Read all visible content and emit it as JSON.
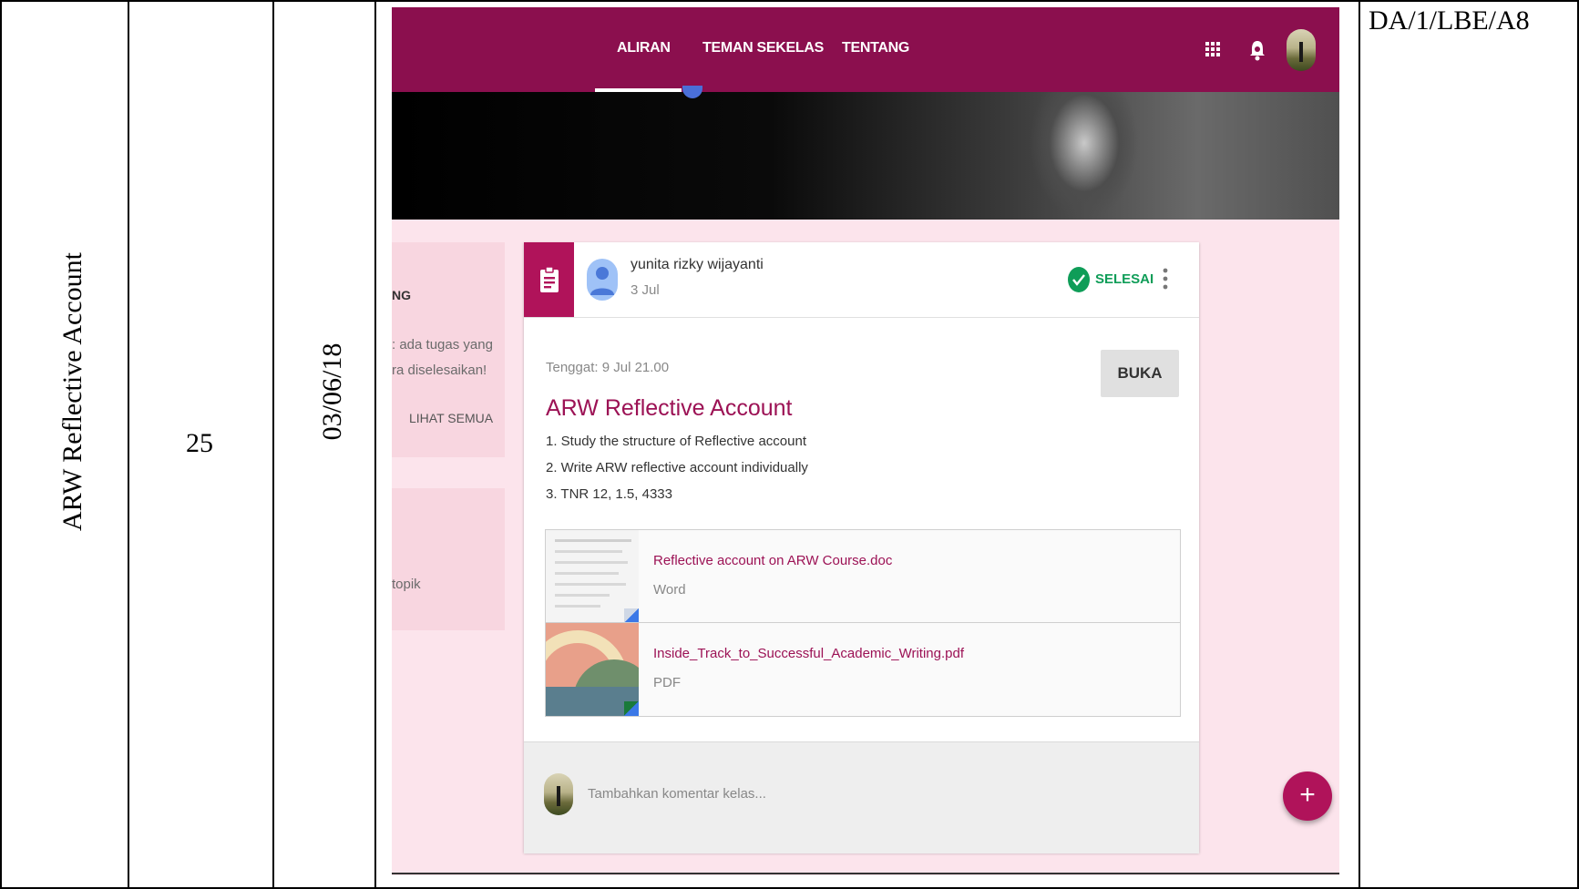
{
  "table": {
    "activity": "ARW Reflective Account",
    "meeting_no": "25",
    "date": "03/06/18",
    "code": "DA/1/LBE/A8"
  },
  "classroom": {
    "tabs": [
      "ALIRAN",
      "TEMAN SEKELAS",
      "TENTANG"
    ],
    "active_tab": "ALIRAN",
    "sidebar": {
      "heading_fragment": "NG",
      "message_line1": ": ada tugas yang",
      "message_line2": "ra diselesaikan!",
      "see_all": "LIHAT SEMUA",
      "topic_fragment": "topik"
    },
    "post": {
      "author": "yunita rizky wijayanti",
      "date": "3 Jul",
      "status": "SELESAI",
      "due": "Tenggat: 9 Jul 21.00",
      "open_button": "BUKA",
      "title": "ARW Reflective Account",
      "instructions": [
        "1. Study the structure of Reflective account",
        "2. Write ARW reflective account individually",
        "3. TNR 12, 1.5, 4333"
      ],
      "attachments": [
        {
          "name": "Reflective account on ARW Course.doc",
          "type": "Word"
        },
        {
          "name": "Inside_Track_to_Successful_Academic_Writing.pdf",
          "type": "PDF"
        }
      ],
      "comment_placeholder": "Tambahkan komentar kelas..."
    },
    "fab_label": "+",
    "colors": {
      "brand": "#8b0f4e",
      "accent": "#b0135a",
      "page_bg": "#fce4ec",
      "done": "#0f9d58"
    }
  }
}
